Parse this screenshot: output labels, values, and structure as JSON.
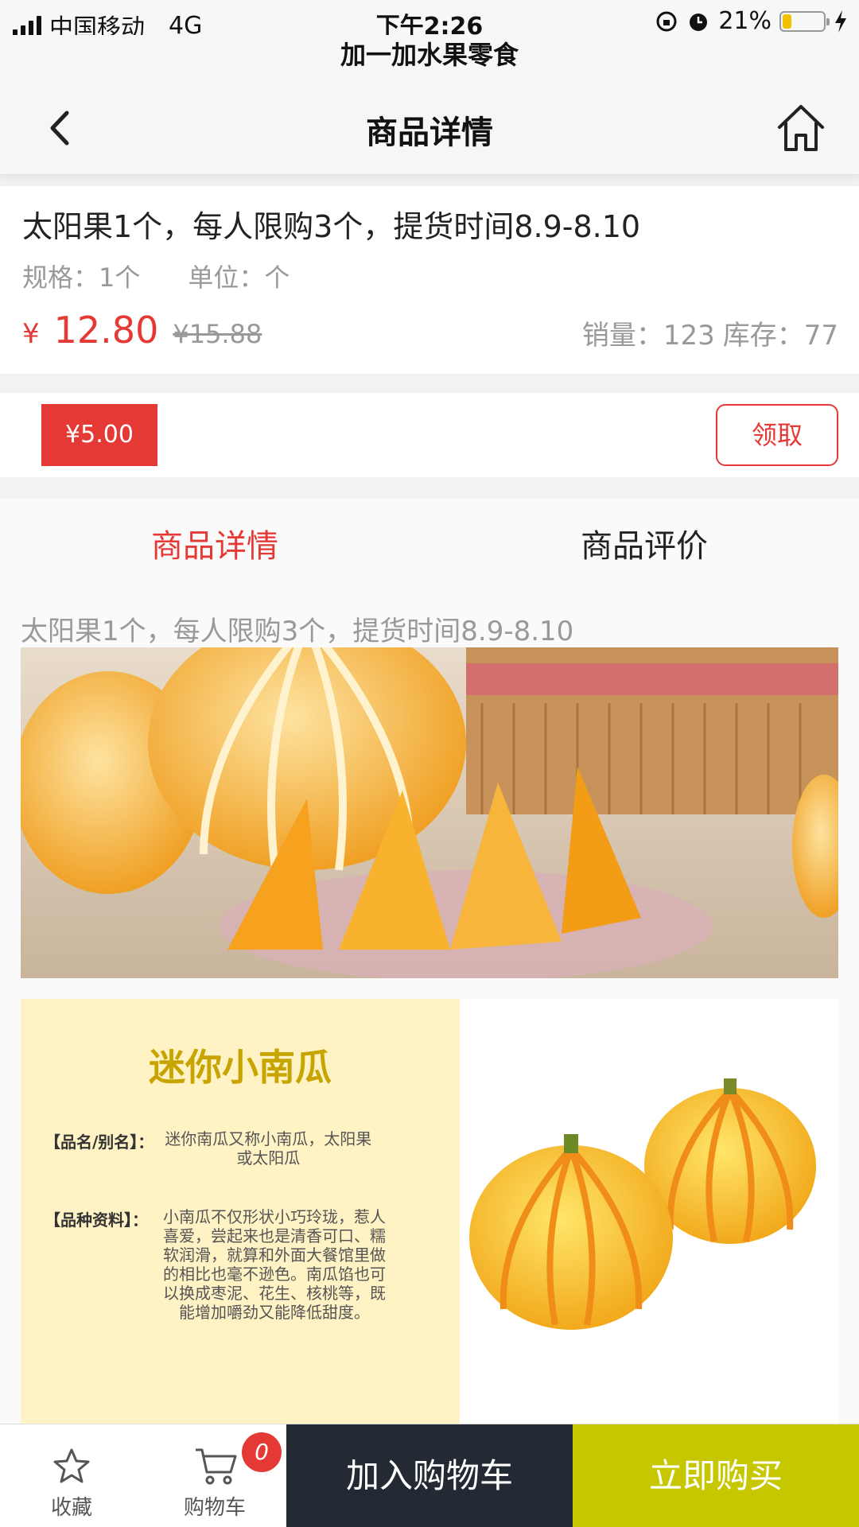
{
  "status_bar": {
    "carrier": "中国移动",
    "network": "4G",
    "time": "下午2:26",
    "battery": "21%",
    "battery_level": 0.21
  },
  "app_title": "加一加水果零食",
  "nav": {
    "title": "商品详情"
  },
  "product": {
    "title": "太阳果1个，每人限购3个，提货时间8.9-8.10",
    "spec_label": "规格：1个",
    "unit_label": "单位：个",
    "currency": "¥",
    "price": "12.80",
    "original_price": "¥15.88",
    "sales": "销量：123",
    "stock": "库存：77"
  },
  "coupon": {
    "amount": "¥5.00",
    "claim_label": "领取"
  },
  "tabs": [
    {
      "label": "商品详情"
    },
    {
      "label": "商品评价"
    }
  ],
  "detail_text": "太阳果1个，每人限购3个，提货时间8.9-8.10",
  "info_panel": {
    "title": "迷你小南瓜",
    "name_key": "【品名/别名】：",
    "name_value": "迷你南瓜又称小南瓜，太阳果或太阳瓜",
    "variety_key": "【品种资料】：",
    "variety_value": "小南瓜不仅形状小巧玲珑，惹人喜爱，尝起来也是清香可口、糯软润滑，就算和外面大餐馆里做的相比也毫不逊色。南瓜馅也可以换成枣泥、花生、核桃等，既能增加嚼劲又能降低甜度。"
  },
  "bottom_bar": {
    "favorite_label": "收藏",
    "cart_label": "购物车",
    "cart_count": "0",
    "add_to_cart": "加入购物车",
    "buy_now": "立即购买"
  },
  "colors": {
    "accent": "#e53935",
    "buy": "#c7c700",
    "dark": "#232a33"
  }
}
